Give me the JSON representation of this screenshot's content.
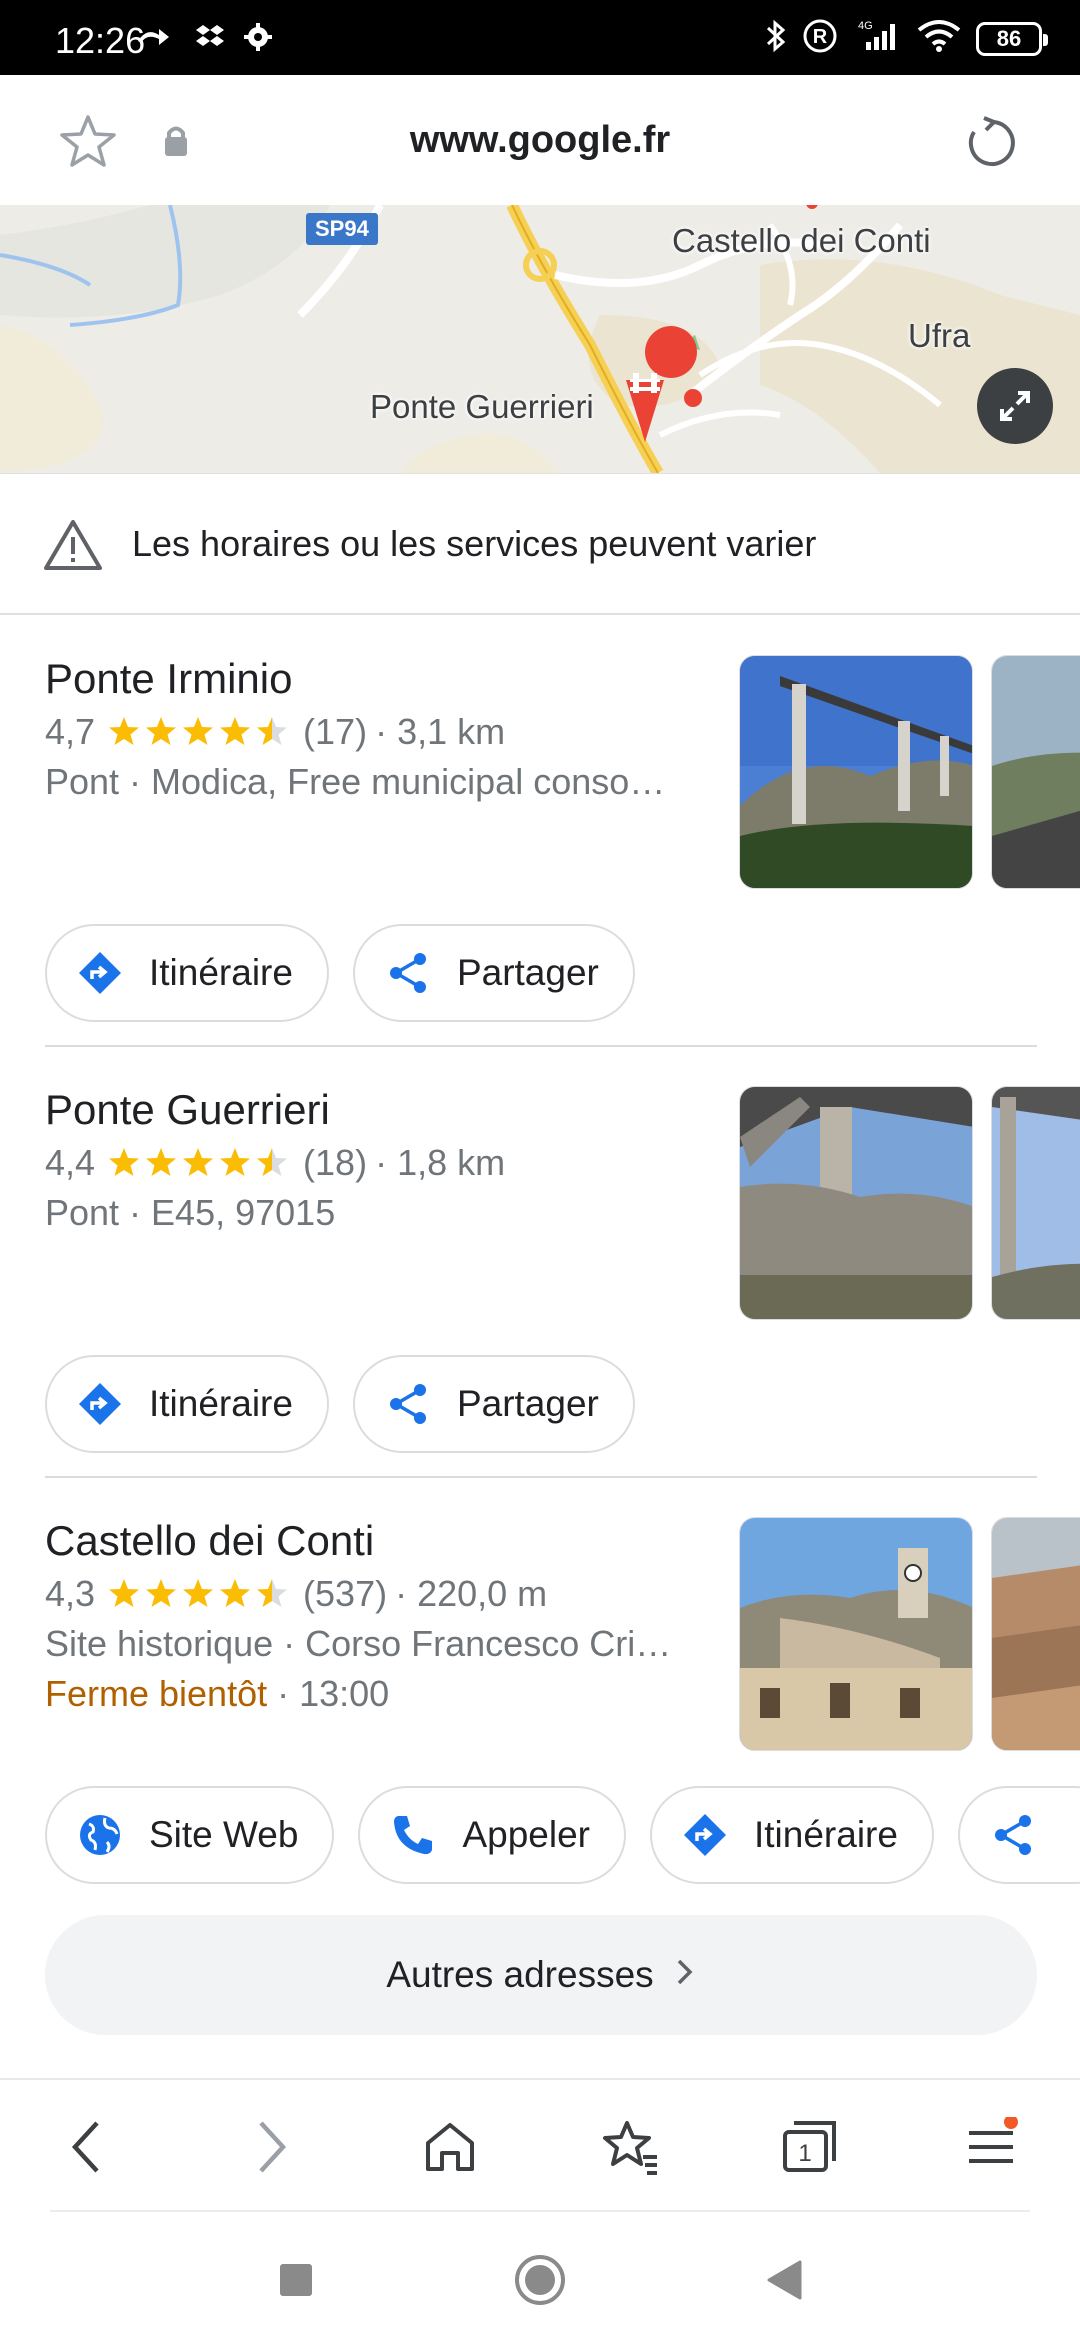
{
  "status_bar": {
    "time": "12:26",
    "battery": "86",
    "network": "4G"
  },
  "url_bar": {
    "url": "www.google.fr"
  },
  "map": {
    "road_badge": "SP94",
    "labels": [
      "Castello dei Conti",
      "Ufra",
      "Ponte Guerrieri"
    ]
  },
  "notice": {
    "text": "Les horaires ou les services peuvent varier"
  },
  "places": [
    {
      "name": "Ponte Irminio",
      "rating": "4,7",
      "reviews": "(17)",
      "distance": "· 3,1 km",
      "category": "Pont · Modica, Free municipal conso…",
      "stars": 4.5,
      "actions": [
        "Itinéraire",
        "Partager"
      ]
    },
    {
      "name": "Ponte Guerrieri",
      "rating": "4,4",
      "reviews": "(18)",
      "distance": "· 1,8 km",
      "category": "Pont · E45, 97015",
      "stars": 4.5,
      "actions": [
        "Itinéraire",
        "Partager"
      ]
    },
    {
      "name": "Castello dei Conti",
      "rating": "4,3",
      "reviews": "(537)",
      "distance": "· 220,0 m",
      "category": "Site historique · Corso Francesco Cri…",
      "hours_status": "Ferme bientôt",
      "hours_time": " · 13:00",
      "stars": 4.5,
      "actions": [
        "Site Web",
        "Appeler",
        "Itinéraire"
      ]
    }
  ],
  "more_button": {
    "label": "Autres adresses"
  },
  "bottom_bar": {
    "tabs_count": "1"
  },
  "colors": {
    "star": "#fbbc04",
    "accent_blue": "#1a73e8",
    "warning": "#b06000",
    "pin_red": "#ea4335"
  }
}
